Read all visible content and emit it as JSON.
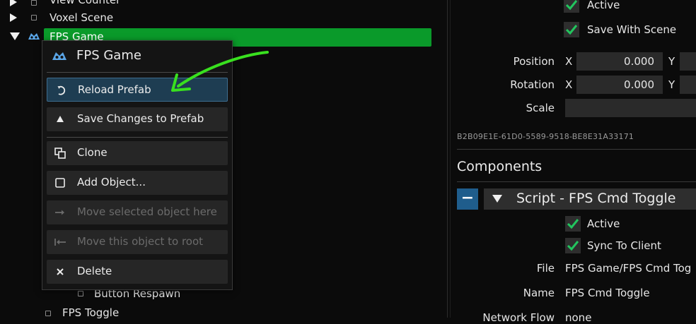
{
  "tree": {
    "items": [
      {
        "label": "View Counter"
      },
      {
        "label": "Voxel Scene"
      },
      {
        "label": "FPS Game"
      },
      {
        "label": "Button Respawn"
      },
      {
        "label": "FPS Toggle"
      }
    ]
  },
  "context_menu": {
    "title": "FPS Game",
    "items": [
      {
        "label": "Reload Prefab",
        "icon": "reload-icon",
        "enabled": true
      },
      {
        "label": "Save Changes to Prefab",
        "icon": "up-triangle-icon",
        "enabled": true
      },
      {
        "label": "Clone",
        "icon": "clone-icon",
        "enabled": true
      },
      {
        "label": "Add Object...",
        "icon": "square-icon",
        "enabled": true
      },
      {
        "label": "Move selected object here",
        "icon": "arrow-right-icon",
        "enabled": false
      },
      {
        "label": "Move this object to root",
        "icon": "arrow-to-left-icon",
        "enabled": false
      },
      {
        "label": "Delete",
        "icon": "close-icon",
        "enabled": true
      }
    ]
  },
  "inspector": {
    "active_label": "Active",
    "save_with_scene_label": "Save With Scene",
    "position_label": "Position",
    "rotation_label": "Rotation",
    "scale_label": "Scale",
    "axis_x": "X",
    "axis_y": "Y",
    "position_x": "0.000",
    "rotation_x": "0.000",
    "guid": "B2B09E1E-61D0-5589-9518-BE8E31A33171",
    "components_label": "Components",
    "component": {
      "remove_symbol": "−",
      "title": "Script - FPS Cmd Toggle",
      "active_label": "Active",
      "sync_label": "Sync To Client",
      "file_label": "File",
      "file_value": "FPS Game/FPS Cmd Tog",
      "name_label": "Name",
      "name_value": "FPS Cmd Toggle",
      "network_label": "Network Flow",
      "network_value": "none"
    }
  },
  "colors": {
    "selection": "#0a9a2a",
    "highlight": "#1e3d52",
    "check": "#22c55e",
    "annotation_arrow": "#39e01f"
  }
}
